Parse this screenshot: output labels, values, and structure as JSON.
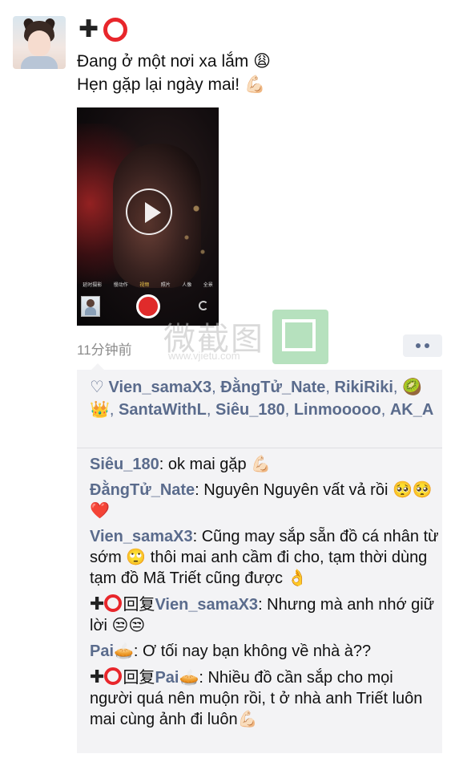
{
  "post": {
    "author_symbols": {
      "plus": "✚"
    },
    "text_line1": "Đang ở một nơi xa lắm",
    "emoji_line1": "😩",
    "text_line2": "Hẹn gặp lại ngày mai!",
    "emoji_line2": "💪🏻",
    "video": {
      "camera_modes": [
        "延时摄影",
        "慢动作",
        "视频",
        "照片",
        "人像",
        "全景"
      ],
      "active_mode": "视频"
    },
    "timestamp": "11分钟前"
  },
  "watermark": {
    "text": "微截图",
    "url": "www.vjietu.com"
  },
  "likes": {
    "heart_icon": "♡",
    "separator": ", ",
    "names": [
      "Vien_samaX3",
      "ĐằngTử_Nate",
      "RikiRiki",
      "🥝 👑",
      "SantaWithL",
      "Siêu_180",
      "Linmooooo",
      "AK_A"
    ]
  },
  "comments": [
    {
      "author": "Siêu_180",
      "text": ": ok mai gặp 💪🏻"
    },
    {
      "author": "ĐằngTử_Nate",
      "text": ": Nguyên Nguyên vất vả rồi 🥺🥺❤️"
    },
    {
      "author": "Vien_samaX3",
      "text": ": Cũng may sắp sẵn đồ cá nhân từ sớm 🙄 thôi mai anh cầm đi cho, tạm thời dùng tạm đồ Mã Triết cũng được 👌"
    },
    {
      "author_prefix": "✚",
      "reply_word": "回复",
      "author": "Vien_samaX3",
      "text": ": Nhưng mà anh nhớ giữ lời 😒😒"
    },
    {
      "author": "Pai🥧",
      "text": ": Ơ tối nay bạn không về nhà à??"
    },
    {
      "author_prefix": "✚",
      "reply_word": "回复",
      "author": "Pai🥧",
      "text": ": Nhiều đồ cần sắp cho mọi người quá nên muộn rồi, t ở nhà anh Triết luôn mai cùng ảnh đi luôn💪🏻"
    }
  ],
  "colors": {
    "link": "#5a6b8c",
    "ring": "#e8262b",
    "comment_bg": "#f3f3f5"
  },
  "icons": {
    "avatar": "avatar-photo",
    "play": "play-icon",
    "more": "more-dots-icon",
    "ring": "red-ring-icon"
  }
}
